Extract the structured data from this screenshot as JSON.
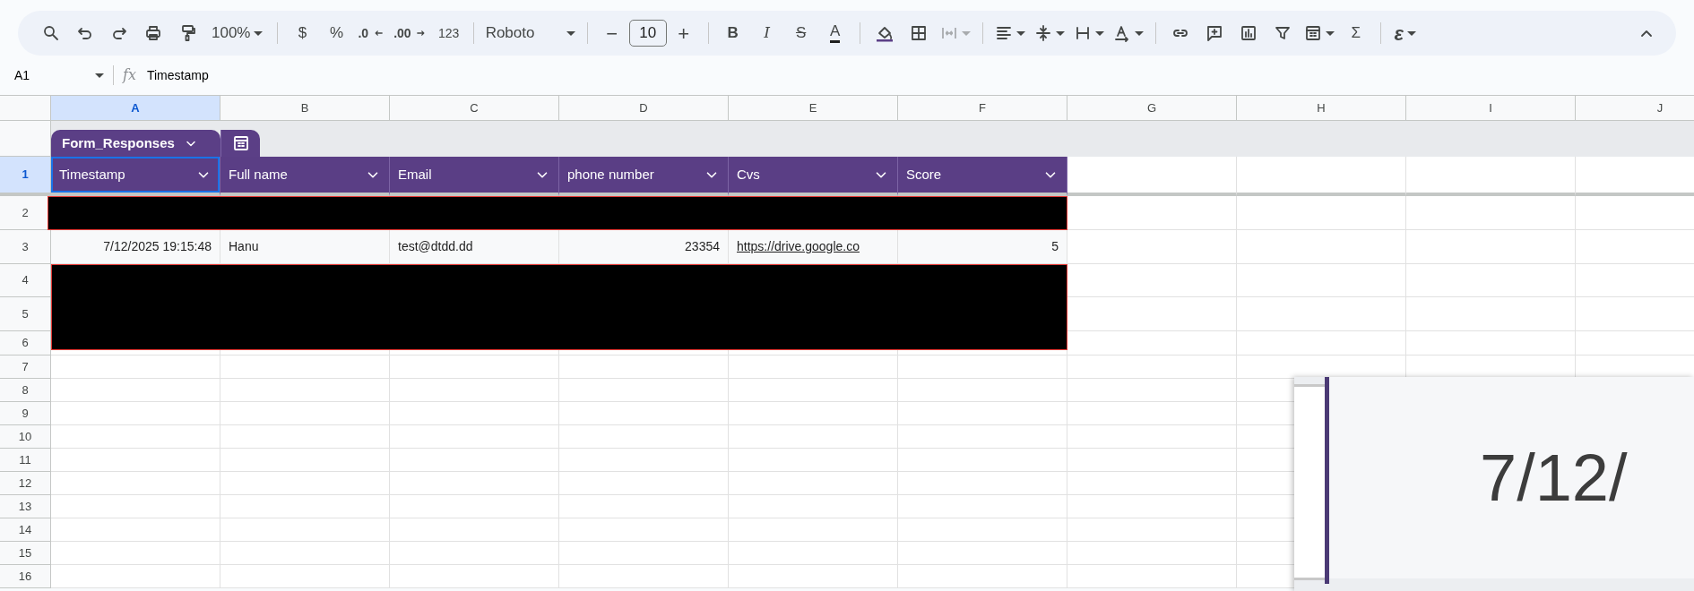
{
  "toolbar": {
    "zoom": "100%",
    "currency": "$",
    "percent": "%",
    "decrease_decimal": ".0",
    "increase_decimal": ".00",
    "number_format": "123",
    "font": "Roboto",
    "font_size_minus": "−",
    "font_size": "10",
    "font_size_plus": "+",
    "bold": "B",
    "italic": "I",
    "strikethrough": "S",
    "text_color": "A",
    "functions": "Σ",
    "ai": "ε"
  },
  "formula_bar": {
    "name_box": "A1",
    "fx": "fx",
    "formula": "Timestamp"
  },
  "columns": [
    {
      "label": "A",
      "selected": true
    },
    {
      "label": "B",
      "selected": false
    },
    {
      "label": "C",
      "selected": false
    },
    {
      "label": "D",
      "selected": false
    },
    {
      "label": "E",
      "selected": false
    },
    {
      "label": "F",
      "selected": false
    },
    {
      "label": "G",
      "selected": false
    },
    {
      "label": "H",
      "selected": false
    },
    {
      "label": "I",
      "selected": false
    },
    {
      "label": "J",
      "selected": false
    }
  ],
  "row_numbers": [
    {
      "label": "1",
      "selected": true
    },
    {
      "label": "2",
      "selected": false
    },
    {
      "label": "3",
      "selected": false
    },
    {
      "label": "4",
      "selected": false
    },
    {
      "label": "5",
      "selected": false
    },
    {
      "label": "6",
      "selected": false
    },
    {
      "label": "7",
      "selected": false
    },
    {
      "label": "8",
      "selected": false
    },
    {
      "label": "9",
      "selected": false
    },
    {
      "label": "10",
      "selected": false
    },
    {
      "label": "11",
      "selected": false
    },
    {
      "label": "12",
      "selected": false
    },
    {
      "label": "13",
      "selected": false
    },
    {
      "label": "14",
      "selected": false
    },
    {
      "label": "15",
      "selected": false
    },
    {
      "label": "16",
      "selected": false
    }
  ],
  "table": {
    "name": "Form_Responses",
    "headers": [
      "Timestamp",
      "Full name",
      "Email",
      "phone number",
      "Cvs",
      "Score"
    ],
    "rows": [
      {
        "kind": "redacted"
      },
      {
        "kind": "data",
        "cells": [
          {
            "kind": "number",
            "text": "7/12/2025 19:15:48"
          },
          {
            "kind": "text",
            "text": "Hanu"
          },
          {
            "kind": "text",
            "text": "test@dtdd.dd"
          },
          {
            "kind": "number",
            "text": "23354"
          },
          {
            "kind": "link",
            "text": "https://drive.google.co"
          },
          {
            "kind": "number",
            "text": "5"
          }
        ]
      },
      {
        "kind": "redacted"
      },
      {
        "kind": "redacted"
      }
    ]
  },
  "zoom_inset": {
    "text": "7/12/"
  }
}
